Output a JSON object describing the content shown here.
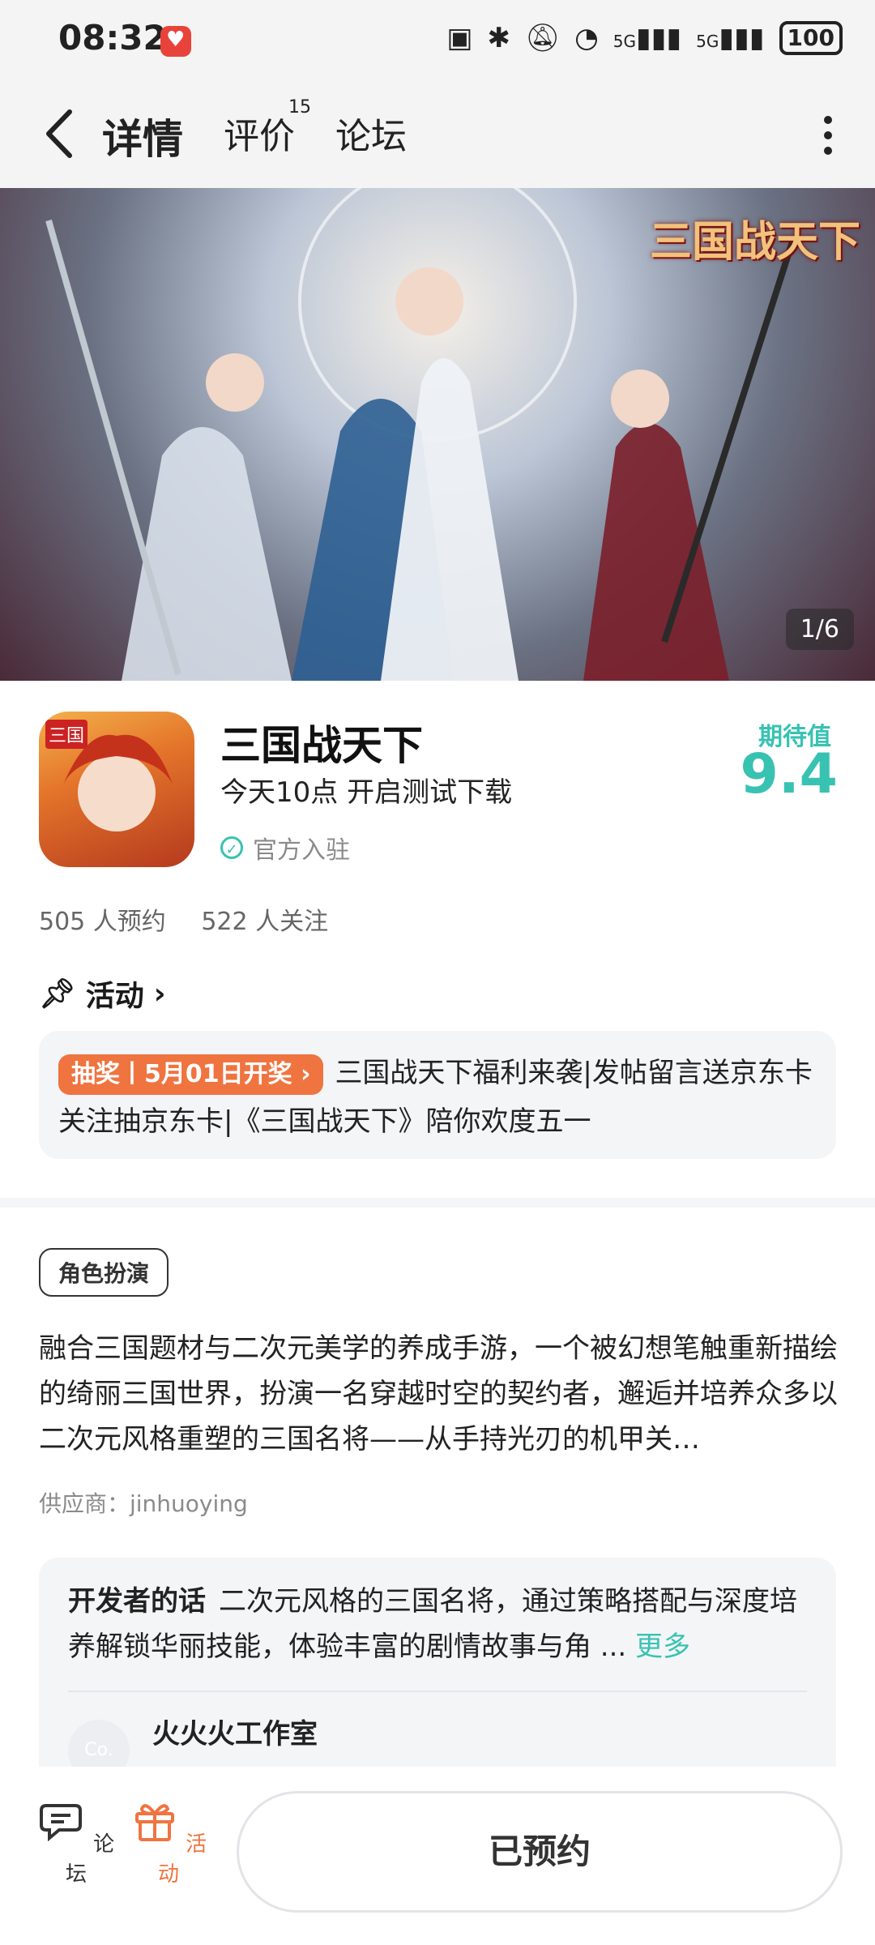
{
  "status_bar": {
    "time": "08:32",
    "signal_1": "5G",
    "signal_2": "5G",
    "battery": "100"
  },
  "nav": {
    "tabs": [
      {
        "label": "详情"
      },
      {
        "label": "评价"
      },
      {
        "label": "论坛"
      }
    ],
    "review_count": "15"
  },
  "banner": {
    "logo_text": "三国战天下",
    "counter": "1/6"
  },
  "app": {
    "name": "三国战天下",
    "subtitle": "今天10点 开启测试下载",
    "verified_label": "官方入驻",
    "expect_label": "期待值",
    "expect_score": "9.4",
    "reservations": "505 人预约",
    "follows": "522 人关注"
  },
  "activity": {
    "title": "活动",
    "tag": "抽奖丨5月01日开奖 ›",
    "text": "三国战天下福利来袭|发帖留言送京东卡 关注抽京东卡|《三国战天下》陪你欢度五一"
  },
  "intro": {
    "genre": "角色扮演",
    "description": "融合三国题材与二次元美学的养成手游，一个被幻想笔触重新描绘的绮丽三国世界，扮演一名穿越时空的契约者，邂逅并培养众多以二次元风格重塑的三国名将——从手持光刃的机甲关…",
    "vendor": "供应商：jinhuoying"
  },
  "developer": {
    "label": "开发者的话",
    "text": "二次元风格的三国名将，通过策略搭配与深度培养解锁华丽技能，体验丰富的剧情故事与角 ... ",
    "more": "更多",
    "avatar_text": "Co.",
    "studio": "火火火工作室"
  },
  "bottom_bar": {
    "forum_label": "论坛",
    "activity_label": "活动",
    "reserve_button": "已预约"
  },
  "colors": {
    "accent": "#38c2b2",
    "activity_orange": "#ef7440"
  }
}
